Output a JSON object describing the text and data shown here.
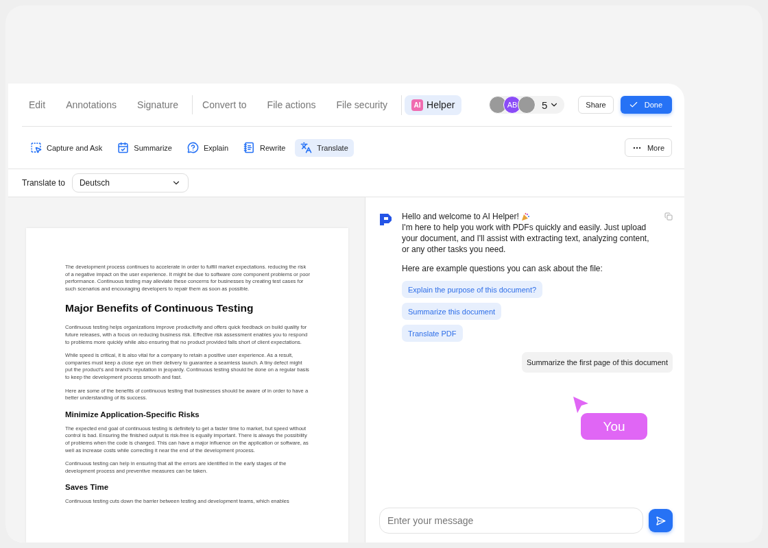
{
  "nav": {
    "groups": [
      {
        "tabs": [
          {
            "label": "Edit",
            "selected": false
          },
          {
            "label": "Annotations",
            "selected": false
          },
          {
            "label": "Signature",
            "selected": false
          }
        ]
      },
      {
        "tabs": [
          {
            "label": "Convert to",
            "selected": false
          },
          {
            "label": "File actions",
            "selected": false
          },
          {
            "label": "File security",
            "selected": false
          }
        ]
      },
      {
        "tabs": [
          {
            "label": "Helper",
            "badge": "AI",
            "selected": true
          }
        ]
      }
    ],
    "avatars": [
      {
        "kind": "photo"
      },
      {
        "kind": "initials",
        "initials": "AB",
        "color": "#8b4cf7"
      },
      {
        "kind": "photo"
      }
    ],
    "collaborator_count": "5",
    "share": "Share",
    "done": "Done"
  },
  "tools": {
    "items": [
      {
        "kind": "capture",
        "label": "Capture and Ask",
        "selected": false
      },
      {
        "kind": "summarize",
        "label": "Summarize",
        "selected": false
      },
      {
        "kind": "explain",
        "label": "Explain",
        "selected": false
      },
      {
        "kind": "rewrite",
        "label": "Rewrite",
        "selected": false
      },
      {
        "kind": "translate",
        "label": "Translate",
        "selected": true
      }
    ],
    "more": "More"
  },
  "translate": {
    "label": "Translate to",
    "value": "Deutsch"
  },
  "document": {
    "blocks": [
      {
        "kind": "p",
        "text": "The development process continues to accelerate in order to fulfill market expectations. reducing the risk of a negative impact on the user experience. It might be due to software core component problems or poor performance. Continuous testing may alleviate these concerns for businesses by creating test cases for such scenarios and encouraging developers to repair them as soon as possible."
      },
      {
        "kind": "h1",
        "text": "Major Benefits of Continuous Testing"
      },
      {
        "kind": "p",
        "text": "Continuous testing helps organizations improve productivity and offers quick feedback on build quality for future releases, with a focus on reducing business risk. Effective risk assessment enables you to respond to problems more quickly while also ensuring that no product provided falls short of client expectations."
      },
      {
        "kind": "p",
        "text": "While speed is critical, it is also vital for a company to retain a positive user experience. As a result, companies must keep a close eye on their delivery to guarantee a seamless launch. A tiny defect might put the product’s and brand’s reputation in jeopardy. Continuous testing should be done on a regular basis to keep the development process smooth and fast."
      },
      {
        "kind": "p",
        "text": "Here are some of the benefits of continuous testing that businesses should be aware of in order to have a better understanding of its success."
      },
      {
        "kind": "h2",
        "text": "Minimize Application-Specific Risks"
      },
      {
        "kind": "p",
        "text": "The expected end goal of continuous testing is definitely to get a faster time to market, but speed without control is bad. Ensuring the finished output is risk-free is equally important. There is always the possibility of problems when the code is changed. This can have a major influence on the application or software, as well as increase costs while correcting it near the end of the development process."
      },
      {
        "kind": "p",
        "text": "Continuous testing can help in ensuring that all the errors are identified in the early stages of the development process and preventive measures can be taken."
      },
      {
        "kind": "h2",
        "text": "Saves Time"
      },
      {
        "kind": "p",
        "text": "Continuous testing cuts down the barrier between testing and development teams, which enables"
      }
    ]
  },
  "chat": {
    "messages": [
      {
        "kind": "assistant",
        "greeting": "Hello and welcome to AI Helper!",
        "text": "I'm here to help you work with PDFs quickly and easily. Just upload your document, and I'll assist with extracting text, analyzing content, or any other tasks you need.",
        "prompt": "Here are example questions you can ask about the file:",
        "suggestions": [
          "Explain the purpose of this document?",
          "Summarize this document",
          "Translate PDF"
        ]
      },
      {
        "kind": "user",
        "text": "Summarize the first page of this document"
      }
    ],
    "cursor_label": "You",
    "input": {
      "placeholder": "Enter your message"
    }
  }
}
